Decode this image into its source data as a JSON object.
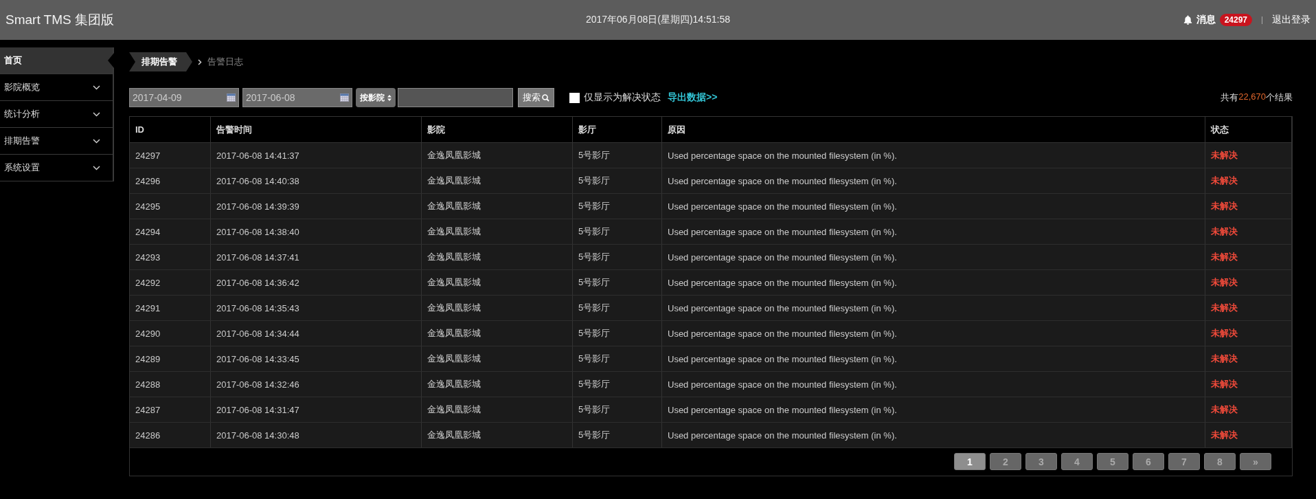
{
  "header": {
    "title": "Smart TMS 集团版",
    "datetime": "2017年06月08日(星期四)14:51:58",
    "messages_label": "消息",
    "messages_count": "24297",
    "logout": "退出登录"
  },
  "sidebar": {
    "items": [
      {
        "label": "首页",
        "kind": "link",
        "selected": true
      },
      {
        "label": "影院概览",
        "kind": "menu",
        "selected": false
      },
      {
        "label": "统计分析",
        "kind": "menu",
        "selected": false
      },
      {
        "label": "排期告警",
        "kind": "menu",
        "selected": false
      },
      {
        "label": "系统设置",
        "kind": "menu",
        "selected": false
      }
    ]
  },
  "breadcrumb": [
    "排期告警",
    "告警日志"
  ],
  "filters": {
    "start_date": "2017-04-09",
    "end_date": "2017-06-08",
    "group_select": "按影院",
    "search_button": "搜索",
    "unresolved_only": {
      "label": "仅显示为解决状态",
      "checked": false
    },
    "export_link": "导出数据>>",
    "result_prefix": "共有",
    "result_count": "22,670",
    "result_suffix": "个结果"
  },
  "table": {
    "columns": [
      "ID",
      "告警时间",
      "影院",
      "影厅",
      "原因",
      "状态"
    ],
    "rows": [
      [
        "24297",
        "2017-06-08 14:41:37",
        "金逸凤凰影城",
        "5号影厅",
        "Used percentage space on the mounted filesystem (in %).",
        "未解决"
      ],
      [
        "24296",
        "2017-06-08 14:40:38",
        "金逸凤凰影城",
        "5号影厅",
        "Used percentage space on the mounted filesystem (in %).",
        "未解决"
      ],
      [
        "24295",
        "2017-06-08 14:39:39",
        "金逸凤凰影城",
        "5号影厅",
        "Used percentage space on the mounted filesystem (in %).",
        "未解决"
      ],
      [
        "24294",
        "2017-06-08 14:38:40",
        "金逸凤凰影城",
        "5号影厅",
        "Used percentage space on the mounted filesystem (in %).",
        "未解决"
      ],
      [
        "24293",
        "2017-06-08 14:37:41",
        "金逸凤凰影城",
        "5号影厅",
        "Used percentage space on the mounted filesystem (in %).",
        "未解决"
      ],
      [
        "24292",
        "2017-06-08 14:36:42",
        "金逸凤凰影城",
        "5号影厅",
        "Used percentage space on the mounted filesystem (in %).",
        "未解决"
      ],
      [
        "24291",
        "2017-06-08 14:35:43",
        "金逸凤凰影城",
        "5号影厅",
        "Used percentage space on the mounted filesystem (in %).",
        "未解决"
      ],
      [
        "24290",
        "2017-06-08 14:34:44",
        "金逸凤凰影城",
        "5号影厅",
        "Used percentage space on the mounted filesystem (in %).",
        "未解决"
      ],
      [
        "24289",
        "2017-06-08 14:33:45",
        "金逸凤凰影城",
        "5号影厅",
        "Used percentage space on the mounted filesystem (in %).",
        "未解决"
      ],
      [
        "24288",
        "2017-06-08 14:32:46",
        "金逸凤凰影城",
        "5号影厅",
        "Used percentage space on the mounted filesystem (in %).",
        "未解决"
      ],
      [
        "24287",
        "2017-06-08 14:31:47",
        "金逸凤凰影城",
        "5号影厅",
        "Used percentage space on the mounted filesystem (in %).",
        "未解决"
      ],
      [
        "24286",
        "2017-06-08 14:30:48",
        "金逸凤凰影城",
        "5号影厅",
        "Used percentage space on the mounted filesystem (in %).",
        "未解决"
      ]
    ]
  },
  "pagination": [
    {
      "label": "1",
      "selected": true
    },
    {
      "label": "2",
      "selected": false
    },
    {
      "label": "3",
      "selected": false
    },
    {
      "label": "4",
      "selected": false
    },
    {
      "label": "5",
      "selected": false
    },
    {
      "label": "6",
      "selected": false
    },
    {
      "label": "7",
      "selected": false
    },
    {
      "label": "8",
      "selected": false
    },
    {
      "label": "»",
      "selected": false
    }
  ]
}
